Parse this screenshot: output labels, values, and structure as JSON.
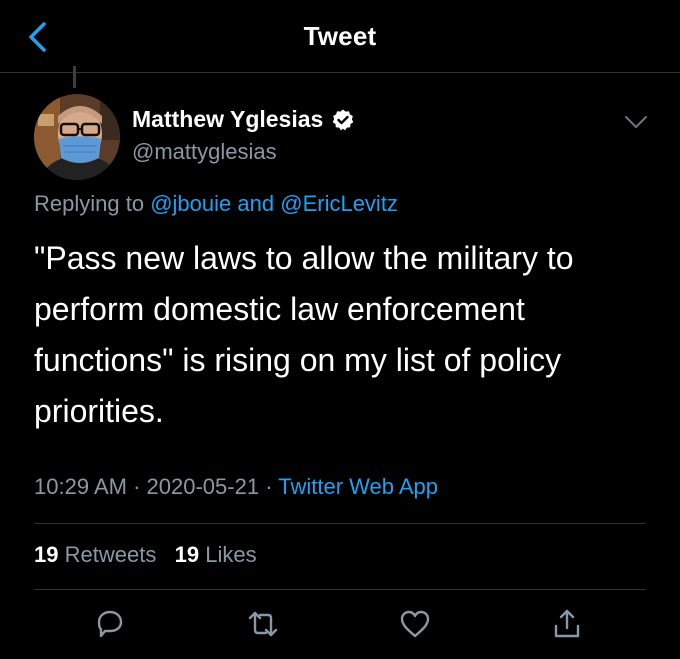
{
  "header": {
    "title": "Tweet"
  },
  "author": {
    "name": "Matthew Yglesias",
    "handle": "@mattyglesias"
  },
  "reply": {
    "prefix": "Replying to",
    "user1": "@jbouie",
    "conj": "and",
    "user2": "@EricLevitz"
  },
  "tweet": {
    "text": "\"Pass new laws to allow the military to\nperform domestic law enforcement\nfunctions\" is rising on my list of policy\npriorities."
  },
  "meta": {
    "time": "10:29 AM",
    "date": "2020-05-21",
    "dot": "·",
    "app": "Twitter Web App"
  },
  "stats": {
    "retweets_count": "19",
    "retweets_label": "Retweets",
    "likes_count": "19",
    "likes_label": "Likes"
  },
  "colors": {
    "accent": "#1da1f2",
    "muted": "#8899a6",
    "background": "#000000",
    "divider": "#2f3336"
  },
  "icons": [
    "back-arrow-icon",
    "verified-badge-icon",
    "chevron-down-icon",
    "reply-icon",
    "retweet-icon",
    "like-icon",
    "share-icon"
  ]
}
